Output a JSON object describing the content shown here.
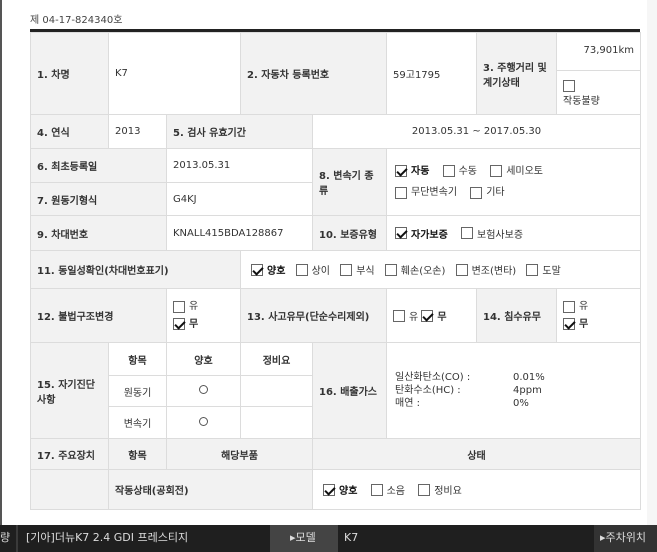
{
  "doc_number": "제 04-17-824340호",
  "rows": {
    "r1": {
      "car_name_label": "1. 차명",
      "car_name": "K7",
      "reg_label": "2. 자동차 등록번호",
      "reg_value": "59고1795",
      "mileage_label": "3. 주행거리 및 계기상태",
      "mileage_value": "73,901km",
      "gauge_opt": "작동불량"
    },
    "r2": {
      "year_label": "4. 연식",
      "year_value": "2013",
      "inspect_label": "5. 검사 유효기간",
      "inspect_value": "2013.05.31 ~ 2017.05.30"
    },
    "r3": {
      "first_reg_label": "6. 최초등록일",
      "first_reg_value": "2013.05.31",
      "trans_label": "8. 변속기 종류",
      "trans_opts": [
        "자동",
        "수동",
        "세미오토",
        "무단변속기",
        "기타"
      ]
    },
    "r4": {
      "engine_label": "7. 원동기형식",
      "engine_value": "G4KJ"
    },
    "r5": {
      "vin_label": "9. 차대번호",
      "vin_value": "KNALL415BDA128867",
      "warranty_label": "10. 보증유형",
      "warranty_opts": [
        "자가보증",
        "보험사보증"
      ]
    },
    "r6": {
      "identity_label": "11. 동일성확인(차대번호표기)",
      "identity_opts": [
        "양호",
        "상이",
        "부식",
        "훼손(오손)",
        "변조(변타)",
        "도말"
      ]
    },
    "r7": {
      "illegal_label": "12. 불법구조변경",
      "illegal_yes": "유",
      "illegal_no": "무",
      "accident_label": "13. 사고유무(단순수리제외)",
      "accident_yes": "유",
      "accident_no": "무",
      "flood_label": "14. 침수유무",
      "flood_yes": "유",
      "flood_no": "무"
    },
    "r8": {
      "selfdiag_label": "15. 자기진단 사항",
      "col_item": "항목",
      "col_good": "양호",
      "col_repair": "정비요",
      "row_engine": "원동기",
      "row_trans": "변속기",
      "emission_label": "16. 배출가스",
      "co_label": "일산화탄소(CO) :",
      "co_value": "0.01%",
      "hc_label": "탄화수소(HC) :",
      "hc_value": "4ppm",
      "smoke_label": "매연 :",
      "smoke_value": "0%"
    },
    "r9": {
      "main_label": "17. 주요장치",
      "col_item": "항목",
      "col_part": "해당부품",
      "col_status": "상태"
    },
    "r10": {
      "idle_label": "작동상태(공회전)",
      "idle_opts": [
        "양호",
        "소음",
        "정비요"
      ]
    }
  },
  "statusbar": {
    "left_stub": "량",
    "title": "[기아]더뉴K7 2.4 GDI 프레스티지",
    "model_label": "▸모델",
    "model_value": "K7",
    "right_label": "▸주차위치"
  }
}
